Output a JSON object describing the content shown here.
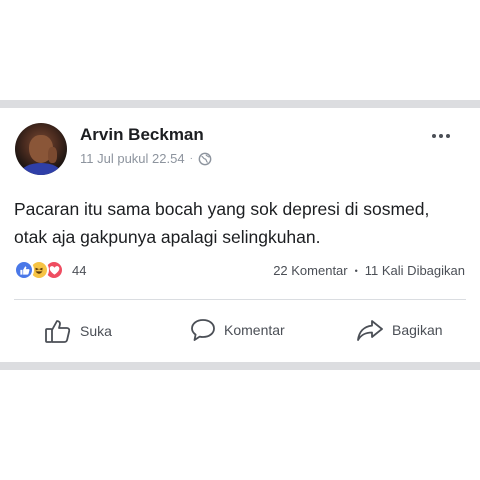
{
  "post": {
    "author": "Arvin Beckman",
    "timestamp": "11 Jul pukul 22.54",
    "meta_separator": "·",
    "privacy_icon": "globe-icon",
    "text_line1": "Pacaran itu sama bocah yang sok depresi di sosmed,",
    "text_line2": "otak aja gakpunya apalagi selingkuhan."
  },
  "reactions": {
    "types": [
      "like",
      "haha",
      "love"
    ],
    "count": "44"
  },
  "stats": {
    "comments": "22 Komentar",
    "separator": "•",
    "shares": "11 Kali Dibagikan"
  },
  "actions": {
    "like_label": "Suka",
    "comment_label": "Komentar",
    "share_label": "Bagikan"
  },
  "colors": {
    "like_blue": "#4a78e8",
    "haha_yellow": "#f6c344",
    "love_red": "#ef4d61",
    "band_gray": "#dcdde0"
  }
}
